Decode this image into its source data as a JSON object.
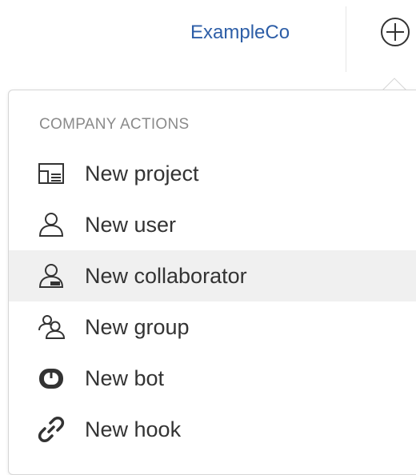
{
  "header": {
    "company_name": "ExampleCo",
    "add_icon": "plus-circle-icon"
  },
  "dropdown": {
    "section_label": "COMPANY ACTIONS",
    "items": [
      {
        "label": "New project",
        "icon": "project-board-icon"
      },
      {
        "label": "New user",
        "icon": "user-icon"
      },
      {
        "label": "New collaborator",
        "icon": "collaborator-icon",
        "highlighted": true
      },
      {
        "label": "New group",
        "icon": "group-icon"
      },
      {
        "label": "New bot",
        "icon": "bot-icon"
      },
      {
        "label": "New hook",
        "icon": "link-icon"
      }
    ]
  },
  "colors": {
    "brand_link": "#2d5ea7",
    "section_label": "#8a8a8a",
    "item_text": "#333333",
    "highlight_bg": "#f0f0f0",
    "icon": "#333333"
  }
}
